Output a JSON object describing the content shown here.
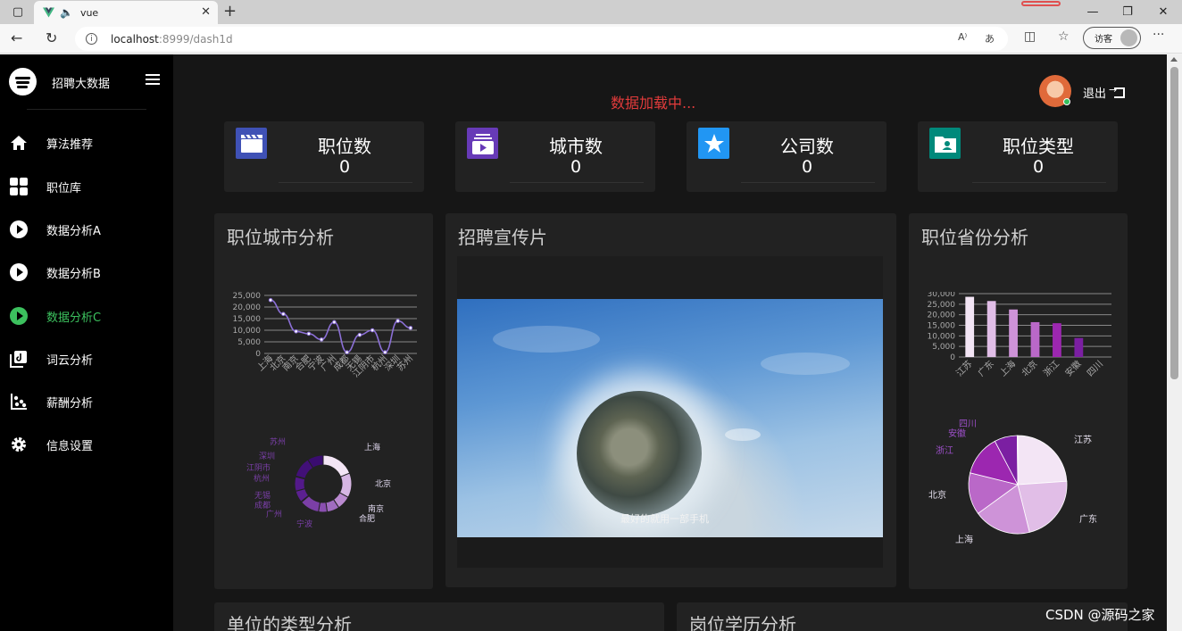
{
  "browser": {
    "tab_title": "vue",
    "url_host": "localhost",
    "url_rest": ":8999/dash1d",
    "guest_label": "访客",
    "read_aloud_icon": "A⁾",
    "translate_icon": "あ"
  },
  "sidebar": {
    "brand_title": "招聘大数据",
    "items": [
      {
        "label": "算法推荐",
        "icon": "home-icon"
      },
      {
        "label": "职位库",
        "icon": "grid-icon"
      },
      {
        "label": "数据分析A",
        "icon": "play-icon"
      },
      {
        "label": "数据分析B",
        "icon": "play-icon"
      },
      {
        "label": "数据分析C",
        "icon": "play-icon",
        "active": true
      },
      {
        "label": "词云分析",
        "icon": "library-icon"
      },
      {
        "label": "薪酬分析",
        "icon": "scatter-icon"
      },
      {
        "label": "信息设置",
        "icon": "gear-icon"
      }
    ]
  },
  "header": {
    "loading_text": "数据加载中...",
    "logout_label": "退出"
  },
  "stats": [
    {
      "title": "职位数",
      "value": "0",
      "color": "#3f51b5",
      "icon": "clapperboard-icon"
    },
    {
      "title": "城市数",
      "value": "0",
      "color": "#673ab7",
      "icon": "video-library-icon"
    },
    {
      "title": "公司数",
      "value": "0",
      "color": "#2196f3",
      "icon": "star-icon"
    },
    {
      "title": "职位类型",
      "value": "0",
      "color": "#00897b",
      "icon": "contact-folder-icon"
    }
  ],
  "panels": {
    "city_title": "职位城市分析",
    "video_title": "招聘宣传片",
    "video_caption": "最好的就用一部手机",
    "province_title": "职位省份分析",
    "company_type_title": "单位的类型分析",
    "education_title": "岗位学历分析"
  },
  "watermark": "CSDN @源码之家",
  "chart_data": [
    {
      "type": "line",
      "categories": [
        "上海",
        "北京",
        "南京",
        "合肥",
        "宁波",
        "广州",
        "成都",
        "无锡",
        "江阴市",
        "杭州",
        "深圳",
        "苏州"
      ],
      "values": [
        23000,
        17000,
        9500,
        8500,
        6000,
        13500,
        500,
        8000,
        10000,
        500,
        14000,
        11000
      ],
      "ylim": [
        0,
        25000
      ],
      "yticks": [
        "0",
        "5,000",
        "10,000",
        "15,000",
        "20,000",
        "25,000"
      ],
      "color": "#8b6fd6"
    },
    {
      "type": "pie",
      "donut": true,
      "categories": [
        "上海",
        "北京",
        "南京",
        "合肥",
        "宁波",
        "广州",
        "成都",
        "无锡",
        "江阴市",
        "杭州",
        "深圳",
        "苏州"
      ],
      "values": [
        23,
        17,
        9.5,
        8.5,
        6,
        13.5,
        0.5,
        8,
        10,
        0.5,
        14,
        11
      ],
      "colors": [
        "#f3e5f5",
        "#d6b6e3",
        "#ba8ad0",
        "#a06cc0",
        "#8a4fb0",
        "#7b3fa6",
        "#6a2c9a",
        "#5c2091",
        "#53198a",
        "#4a1480",
        "#421078",
        "#3a0c70"
      ]
    },
    {
      "type": "bar",
      "categories": [
        "江苏",
        "广东",
        "上海",
        "北京",
        "浙江",
        "安徽",
        "四川"
      ],
      "values": [
        28500,
        26500,
        22500,
        16500,
        16000,
        9000,
        0
      ],
      "ylim": [
        0,
        30000
      ],
      "yticks": [
        "0",
        "5,000",
        "10,000",
        "15,000",
        "20,000",
        "25,000",
        "30,000"
      ],
      "colors": [
        "#f3e5f5",
        "#e1bee7",
        "#ce93d8",
        "#ba68c8",
        "#9c27b0",
        "#7b1fa2",
        "#6a1b9a"
      ]
    },
    {
      "type": "pie",
      "donut": false,
      "categories": [
        "江苏",
        "广东",
        "上海",
        "北京",
        "浙江",
        "安徽",
        "四川"
      ],
      "values": [
        28500,
        26500,
        22500,
        16500,
        16000,
        9000,
        200
      ],
      "colors": [
        "#f3e5f5",
        "#e1bee7",
        "#ce93d8",
        "#ba68c8",
        "#9c27b0",
        "#7b1fa2",
        "#6a1b9a"
      ]
    }
  ]
}
